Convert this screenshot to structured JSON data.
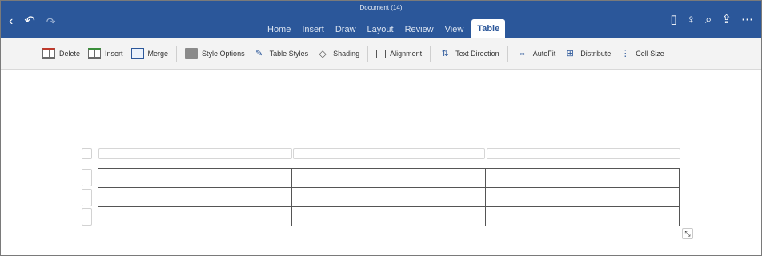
{
  "window": {
    "doc_title": "Document (14)"
  },
  "nav": {
    "back": "‹",
    "undo": "↶",
    "redo": "↷"
  },
  "tabs": [
    {
      "label": "Home"
    },
    {
      "label": "Insert"
    },
    {
      "label": "Draw"
    },
    {
      "label": "Layout"
    },
    {
      "label": "Review"
    },
    {
      "label": "View"
    },
    {
      "label": "Table",
      "active": true
    }
  ],
  "right_icons": [
    {
      "name": "phone-icon",
      "glyph": "▯"
    },
    {
      "name": "lightbulb-icon",
      "glyph": "♀"
    },
    {
      "name": "search-icon",
      "glyph": "⌕"
    },
    {
      "name": "share-icon",
      "glyph": "⇪"
    },
    {
      "name": "more-icon",
      "glyph": "⋯"
    }
  ],
  "ribbon": {
    "delete": "Delete",
    "insert": "Insert",
    "merge": "Merge",
    "style_options": "Style Options",
    "table_styles": "Table Styles",
    "shading": "Shading",
    "alignment": "Alignment",
    "text_direction": "Text Direction",
    "autofit": "AutoFit",
    "distribute": "Distribute",
    "cell_size": "Cell Size"
  },
  "table": {
    "rows": [
      [
        "",
        "",
        ""
      ],
      [
        "",
        "",
        ""
      ],
      [
        "",
        "",
        ""
      ]
    ]
  },
  "colors": {
    "brand": "#2b579a",
    "ribbon_bg": "#f3f3f3"
  }
}
